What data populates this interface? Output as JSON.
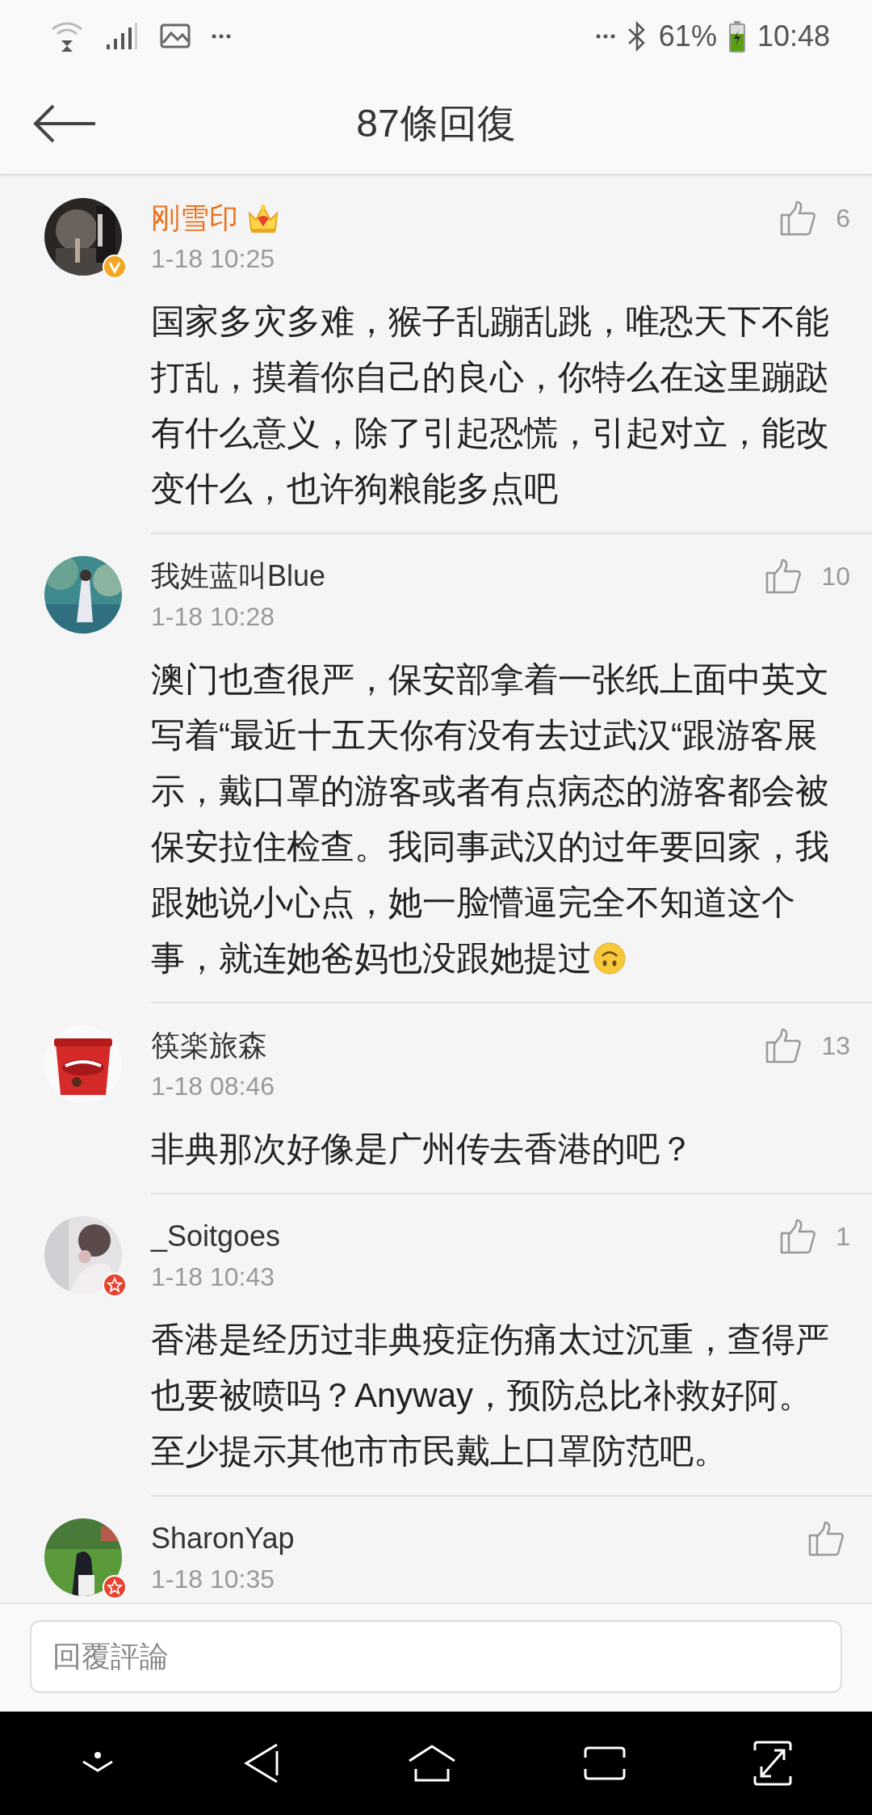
{
  "status_bar": {
    "battery": "61%",
    "time": "10:48"
  },
  "header": {
    "title": "87條回復"
  },
  "comments": [
    {
      "name": "刚雪印",
      "vip": true,
      "badge": {
        "kind": "verified"
      },
      "time": "1-18 10:25",
      "likes": "6",
      "text": "国家多灾多难，猴子乱蹦乱跳，唯恐天下不能打乱，摸着你自己的良心，你特么在这里蹦跶有什么意义，除了引起恐慌，引起对立，能改变什么，也许狗粮能多点吧"
    },
    {
      "name": "我姓蓝叫Blue",
      "vip": false,
      "time": "1-18 10:28",
      "likes": "10",
      "text": "澳门也查很严，保安部拿着一张纸上面中英文写着“最近十五天你有没有去过武汉“跟游客展示，戴口罩的游客或者有点病态的游客都会被保安拉住检查。我同事武汉的过年要回家，我跟她说小心点，她一脸懵逼完全不知道这个事，就连她爸妈也没跟她提过",
      "trailing_emoji": true
    },
    {
      "name": "筷楽旅森",
      "vip": false,
      "time": "1-18 08:46",
      "likes": "13",
      "text": "非典那次好像是广州传去香港的吧？"
    },
    {
      "name": "_Soitgoes",
      "vip": false,
      "badge": {
        "kind": "star"
      },
      "time": "1-18 10:43",
      "likes": "1",
      "text": "香港是经历过非典疫症伤痛太过沉重，查得严也要被喷吗？Anyway，预防总比补救好阿。至少提示其他市市民戴上口罩防范吧。"
    },
    {
      "name": "SharonYap",
      "vip": false,
      "badge": {
        "kind": "star"
      },
      "time": "1-18 10:35"
    }
  ],
  "reply_field": {
    "placeholder": "回覆評論"
  }
}
